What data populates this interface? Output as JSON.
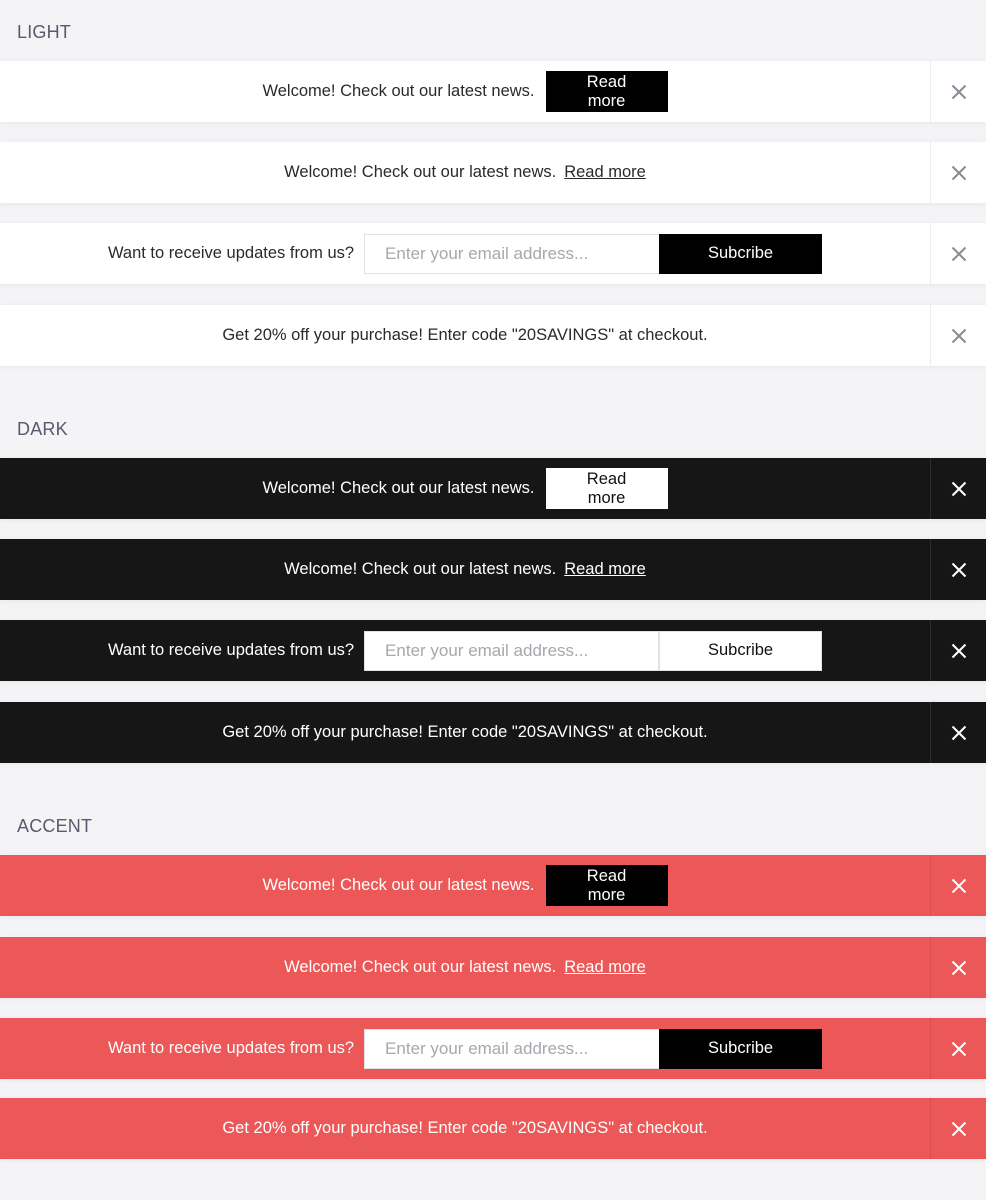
{
  "sections": [
    {
      "title": "LIGHT",
      "bars": [
        {
          "message": "Welcome! Check out our latest news.",
          "action_label": "Read more"
        },
        {
          "message": "Welcome! Check out our latest news.",
          "link_label": "Read more"
        },
        {
          "message": "Want to receive updates from us?",
          "email_placeholder": "Enter your email address...",
          "subscribe_label": "Subcribe"
        },
        {
          "message": "Get 20% off your purchase! Enter code \"20SAVINGS\" at checkout."
        }
      ]
    },
    {
      "title": "DARK",
      "bars": [
        {
          "message": "Welcome! Check out our latest news.",
          "action_label": "Read more"
        },
        {
          "message": "Welcome! Check out our latest news.",
          "link_label": "Read more"
        },
        {
          "message": "Want to receive updates from us?",
          "email_placeholder": "Enter your email address...",
          "subscribe_label": "Subcribe"
        },
        {
          "message": "Get 20% off your purchase! Enter code \"20SAVINGS\" at checkout."
        }
      ]
    },
    {
      "title": "ACCENT",
      "bars": [
        {
          "message": "Welcome! Check out our latest news.",
          "action_label": "Read more"
        },
        {
          "message": "Welcome! Check out our latest news.",
          "link_label": "Read more"
        },
        {
          "message": "Want to receive updates from us?",
          "email_placeholder": "Enter your email address...",
          "subscribe_label": "Subcribe"
        },
        {
          "message": "Get 20% off your purchase! Enter code \"20SAVINGS\" at checkout."
        }
      ]
    }
  ],
  "icons": {
    "close": "close-icon"
  },
  "colors": {
    "page_background": "#f4f4f6",
    "light_bar": "#ffffff",
    "dark_bar": "#161616",
    "accent_bar": "#ec5757",
    "button_black": "#000000",
    "section_title": "#5a5a6e"
  }
}
